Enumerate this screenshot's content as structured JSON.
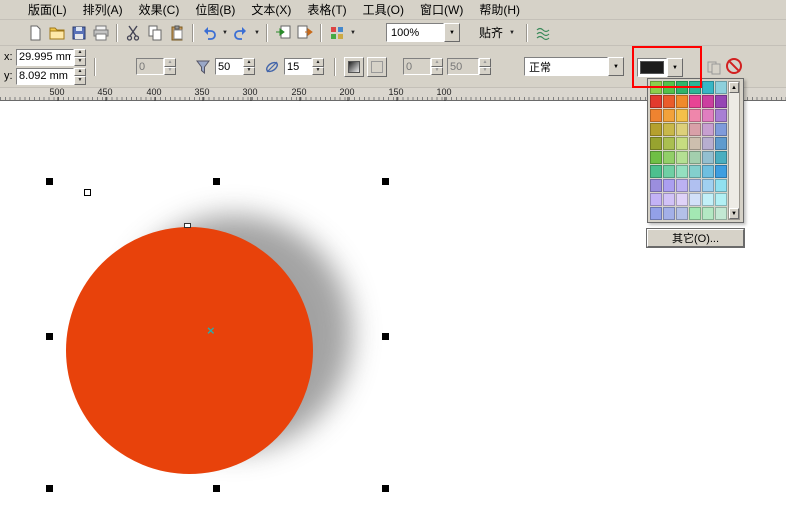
{
  "menubar": {
    "items": [
      "版面(L)",
      "排列(A)",
      "效果(C)",
      "位图(B)",
      "文本(X)",
      "表格(T)",
      "工具(O)",
      "窗口(W)",
      "帮助(H)"
    ]
  },
  "toolbar": {
    "icons": [
      "new",
      "open",
      "save",
      "print",
      "cut",
      "copy",
      "paste",
      "undo",
      "redo",
      "import",
      "export",
      "application-launcher",
      "options"
    ],
    "zoom_value": "100%",
    "snap_label": "贴齐"
  },
  "propbar": {
    "x_label": "x:",
    "x_value": "29.995 mm",
    "y_label": "y:",
    "y_value": "8.092 mm",
    "fade_value": "0",
    "opacity_value": "50",
    "feather_value": "15",
    "locked_value_1": "0",
    "locked_value_2": "50",
    "blend_mode_value": "正常",
    "shadow_color": "#1c1c1c"
  },
  "annotation": {
    "highlight_color": "#ff0000"
  },
  "ruler": {
    "labels": [
      "500",
      "450",
      "400",
      "350",
      "300",
      "250",
      "200",
      "150",
      "100"
    ]
  },
  "canvas": {
    "circle_color": "#e8420b",
    "shadow_color": "#8c8c8c",
    "center_marker": "×"
  },
  "color_popup": {
    "other_label": "其它(O)...",
    "rows": [
      [
        "#8ccf4c",
        "#53c24a",
        "#2eb46a",
        "#2db596",
        "#38b6c5",
        "#8ed0dc"
      ],
      [
        "#e23a2e",
        "#ea5c2b",
        "#f08a2b",
        "#e84394",
        "#cb3f9f",
        "#9646b4"
      ],
      [
        "#ef8330",
        "#f2a23a",
        "#f4c04a",
        "#ef86ab",
        "#e07ec0",
        "#a87fd4"
      ],
      [
        "#b5a02e",
        "#c9b84a",
        "#ddd07a",
        "#d9a0a8",
        "#c79fd0",
        "#7f9bdb"
      ],
      [
        "#97a32f",
        "#aabf50",
        "#c6dc80",
        "#cdbfae",
        "#b7aed0",
        "#5e9bce"
      ],
      [
        "#6fbf45",
        "#92cf68",
        "#b4e093",
        "#a3cfae",
        "#93bfd0",
        "#4aaec0"
      ],
      [
        "#4cbf8e",
        "#70cfa4",
        "#94dfc0",
        "#83cfcd",
        "#6fbfe0",
        "#3e9ee0"
      ],
      [
        "#9b8ede",
        "#ab9ff0",
        "#bcb1f2",
        "#b0c0f0",
        "#a0d0f0",
        "#90e0f0"
      ],
      [
        "#c3b2f6",
        "#d1c2f7",
        "#dfd2f8",
        "#d2e0f8",
        "#c2f0f8",
        "#b2f0f4"
      ],
      [
        "#93a0e8",
        "#a3b0e8",
        "#b3c0e8",
        "#a3e8b3",
        "#b3e8c3",
        "#c3e8d3"
      ]
    ]
  }
}
